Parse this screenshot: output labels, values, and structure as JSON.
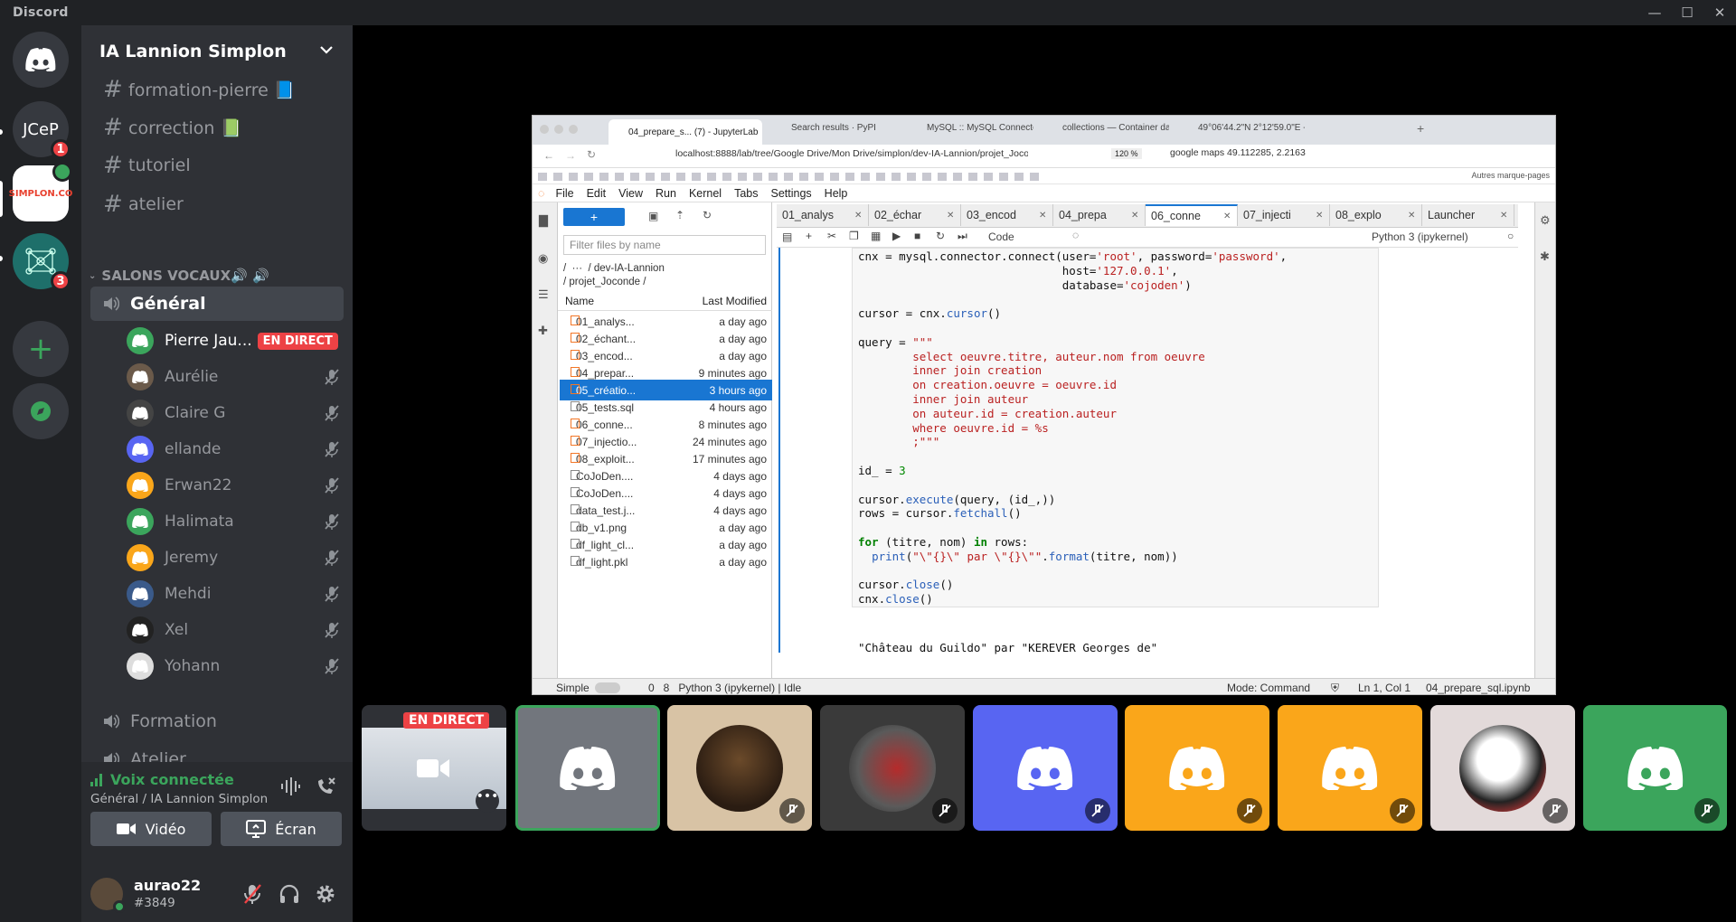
{
  "titlebar": {
    "brand": "Discord"
  },
  "guilds": [
    {
      "label": "JCeP",
      "badge": "1"
    },
    {
      "label": "SIMPLON.CO"
    },
    {
      "label": "",
      "badge": "3"
    }
  ],
  "server": {
    "name": "IA Lannion Simplon"
  },
  "text_channels": [
    "formation-pierre 📘",
    "correction 📗",
    "tutoriel",
    "atelier"
  ],
  "voice_category": "SALONS VOCAUX🔊 🔊",
  "voice_channels": {
    "active": "Général",
    "others": [
      "Formation",
      "Atelier"
    ]
  },
  "voice_users": [
    {
      "name": "Pierre Jau...",
      "live": "EN DIRECT",
      "color": "#3ba55c"
    },
    {
      "name": "Aurélie",
      "color": "#6b5a4a"
    },
    {
      "name": "Claire G",
      "color": "#444"
    },
    {
      "name": "ellande",
      "color": "#5865f2"
    },
    {
      "name": "Erwan22",
      "color": "#faa61a"
    },
    {
      "name": "Halimata",
      "color": "#3ba55c"
    },
    {
      "name": "Jeremy",
      "color": "#faa61a"
    },
    {
      "name": "Mehdi",
      "color": "#3a5a8a"
    },
    {
      "name": "Xel",
      "color": "#222"
    },
    {
      "name": "Yohann",
      "color": "#ddd"
    }
  ],
  "voice_panel": {
    "status": "Voix connectée",
    "location": "Général / IA Lannion Simplon",
    "video": "Vidéo",
    "screen": "Écran"
  },
  "user": {
    "name": "aurao22",
    "tag": "#3849"
  },
  "jupyter": {
    "browser_tabs": [
      "04_prepare_s... (7) - JupyterLab",
      "Search results · PyPI",
      "MySQL :: MySQL Connector/Pyt",
      "collections — Container datatyp",
      "49°06'44.2\"N 2°12'59.0\"E - Go"
    ],
    "url": "localhost:8888/lab/tree/Google Drive/Mon Drive/simplon/dev-IA-Lannion/projet_Joco",
    "zoom": "120 %",
    "search": "google maps 49.112285, 2.21638",
    "bookmarks": "Autres marque-pages",
    "menu": [
      "File",
      "Edit",
      "View",
      "Run",
      "Kernel",
      "Tabs",
      "Settings",
      "Help"
    ],
    "filter_placeholder": "Filter files by name",
    "path": "/  ···  / dev-IA-Lannion\n/ projet_Joconde /",
    "col_name": "Name",
    "col_modified": "Last Modified",
    "files": [
      {
        "name": "01_analys...",
        "mod": "a day ago"
      },
      {
        "name": "02_échant...",
        "mod": "a day ago"
      },
      {
        "name": "03_encod...",
        "mod": "a day ago"
      },
      {
        "name": "04_prepar...",
        "mod": "9 minutes ago"
      },
      {
        "name": "05_créatio...",
        "mod": "3 hours ago"
      },
      {
        "name": "05_tests.sql",
        "mod": "4 hours ago"
      },
      {
        "name": "06_conne...",
        "mod": "8 minutes ago"
      },
      {
        "name": "07_injectio...",
        "mod": "24 minutes ago"
      },
      {
        "name": "08_exploit...",
        "mod": "17 minutes ago"
      },
      {
        "name": "CoJoDen....",
        "mod": "4 days ago"
      },
      {
        "name": "CoJoDen....",
        "mod": "4 days ago"
      },
      {
        "name": "data_test.j...",
        "mod": "4 days ago"
      },
      {
        "name": "db_v1.png",
        "mod": "a day ago"
      },
      {
        "name": "df_light_cl...",
        "mod": "a day ago"
      },
      {
        "name": "df_light.pkl",
        "mod": "a day ago"
      }
    ],
    "nb_tabs": [
      "01_analys",
      "02_échar",
      "03_encod",
      "04_prepa",
      "06_conne",
      "07_injecti",
      "08_explo",
      "Launcher"
    ],
    "cell_type": "Code",
    "kernel": "Python 3 (ipykernel)",
    "output": "\"Château du Guildo\" par \"KEREVER Georges de\"",
    "status_left": "Simple",
    "status_mid": "0   8   Python 3 (ipykernel) | Idle",
    "status_mode": "Mode: Command",
    "status_pos": "Ln 1, Col 1",
    "status_file": "04_prepare_sql.ipynb"
  },
  "tiles": {
    "live": "EN DIRECT"
  }
}
